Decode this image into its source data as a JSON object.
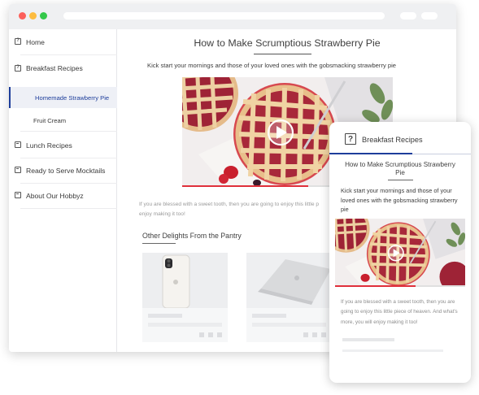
{
  "sidebar": {
    "items": [
      {
        "label": "Home",
        "icon": "help-square-icon"
      },
      {
        "label": "Breakfast Recipes",
        "icon": "help-square-icon"
      },
      {
        "label": "Homemade Strawberry Pie",
        "icon": "",
        "active": true
      },
      {
        "label": "Fruit Cream",
        "icon": ""
      },
      {
        "label": "Lunch Recipes",
        "icon": "book-icon"
      },
      {
        "label": "Ready to Serve Mocktails",
        "icon": "book-icon"
      },
      {
        "label": "About Our Hobbyz",
        "icon": "book-icon"
      }
    ]
  },
  "article": {
    "title": "How to Make Scrumptious Strawberry Pie",
    "lead": "Kick start your mornings and those of your loved ones with the gobsmacking strawberry pie",
    "video_progress": 0.6,
    "body_line1": "If you are blessed with a sweet tooth, then you are going to enjoy this little p",
    "body_line2": "enjoy making it too!",
    "section_title": "Other Delights From the Pantry",
    "cards": [
      {
        "image": "smartphone-product-image"
      },
      {
        "image": "laptop-product-image"
      }
    ]
  },
  "mobile": {
    "header_icon": "help-square-icon",
    "header_title": "Breakfast Recipes",
    "title": "How to Make Scrumptious Strawberry Pie",
    "lead": "Kick start your mornings and those of your loved ones with the gobsmacking strawberry pie",
    "video_progress": 0.62,
    "body": "If you are blessed with a sweet tooth, then you are going to enjoy this little piece of heaven. And what's more, you will enjoy making it too!"
  },
  "colors": {
    "accent": "#1e3e9b",
    "progress_red": "#e0303b",
    "window_dot_red": "#fc605b",
    "window_dot_yellow": "#fdbc40",
    "window_dot_green": "#34c84a"
  }
}
